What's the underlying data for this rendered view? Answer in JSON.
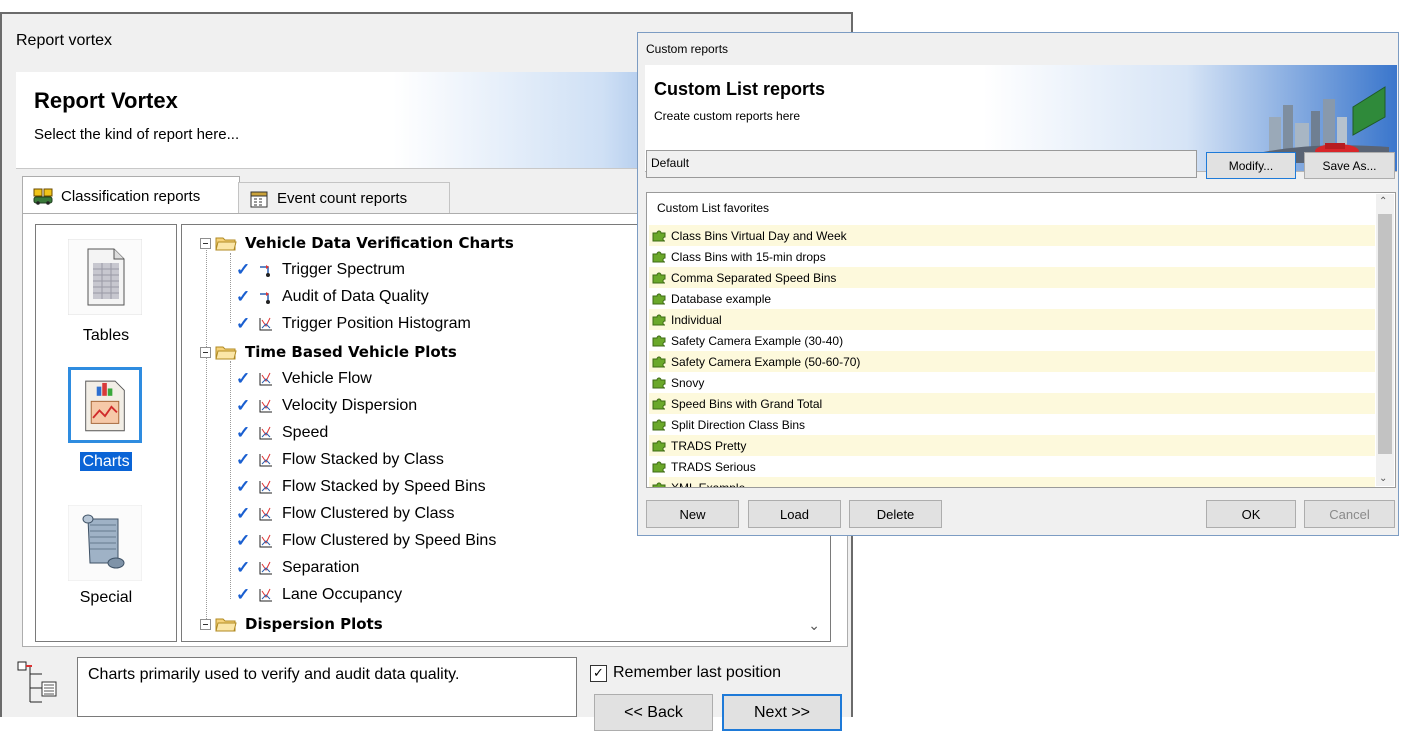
{
  "report_vortex": {
    "window_title": "Report vortex",
    "banner_title": "Report Vortex",
    "banner_subtitle": "Select the kind of report here...",
    "tabs": [
      {
        "label": "Classification reports",
        "active": true,
        "icon": "vehicle-classification-icon"
      },
      {
        "label": "Event count reports",
        "active": false,
        "icon": "calendar-count-icon"
      }
    ],
    "kinds": [
      {
        "label": "Tables",
        "icon": "table-document-icon"
      },
      {
        "label": "Charts",
        "icon": "chart-document-icon",
        "selected": true
      },
      {
        "label": "Special",
        "icon": "scroll-icon"
      }
    ],
    "tree": {
      "groups": [
        {
          "label": "Vehicle Data Verification Charts",
          "items": [
            "Trigger Spectrum",
            "Audit of Data Quality",
            "Trigger Position Histogram"
          ]
        },
        {
          "label": "Time Based Vehicle Plots",
          "items": [
            "Vehicle Flow",
            "Velocity Dispersion",
            "Speed",
            "Flow Stacked by Class",
            "Flow Stacked by Speed Bins",
            "Flow Clustered by Class",
            "Flow Clustered by Speed Bins",
            "Separation",
            "Lane Occupancy"
          ]
        },
        {
          "label": "Dispersion Plots",
          "items": []
        }
      ]
    },
    "description": "Charts primarily used to verify and audit data quality.",
    "remember_label": "Remember last position",
    "remember_checked": true,
    "back_label": "<< Back",
    "next_label": "Next >>"
  },
  "custom_reports": {
    "window_title": "Custom reports",
    "banner_title": "Custom List reports",
    "banner_subtitle": "Create custom reports here",
    "layout_value": "Default",
    "modify_label": "Modify...",
    "save_as_label": "Save As...",
    "favorites_header": "Custom List favorites",
    "favorites": [
      "Class Bins Virtual Day and Week",
      "Class Bins with 15-min drops",
      "Comma Separated Speed Bins",
      "Database example",
      "Individual",
      "Safety Camera Example (30-40)",
      "Safety Camera Example (50-60-70)",
      "Snovy",
      "Speed Bins with Grand Total",
      "Split Direction Class Bins",
      "TRADS Pretty",
      "TRADS Serious",
      "XML Example"
    ],
    "new_label": "New",
    "load_label": "Load",
    "delete_label": "Delete",
    "ok_label": "OK",
    "cancel_label": "Cancel"
  },
  "colors": {
    "accent_blue": "#2e8ce0",
    "selection_blue": "#0a64d6",
    "check_blue": "#1a5fd0",
    "favorite_stripe": "#fdf9dc",
    "puzzle_green": "#6aa82a"
  }
}
